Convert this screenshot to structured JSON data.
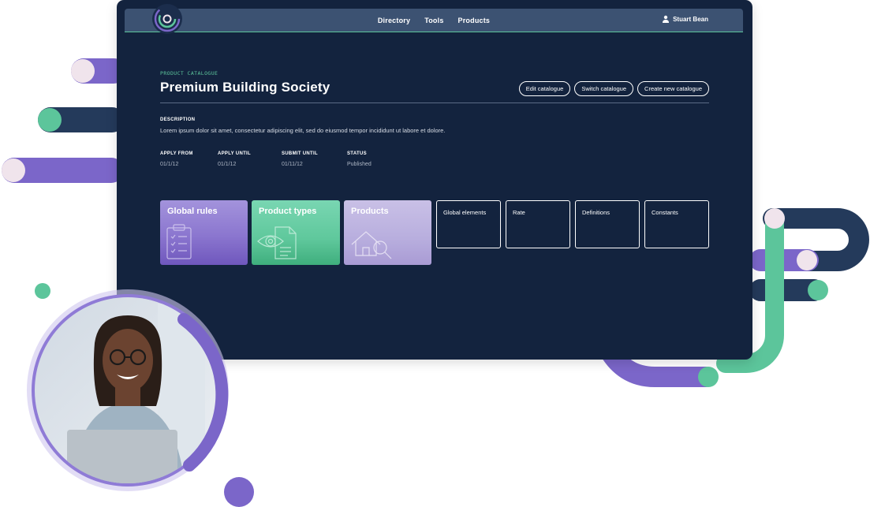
{
  "nav": {
    "items": [
      "Directory",
      "Tools",
      "Products"
    ],
    "user_name": "Stuart Bean"
  },
  "header": {
    "eyebrow": "PRODUCT CATALOGUE",
    "title": "Premium Building Society",
    "actions": [
      "Edit catalogue",
      "Switch catalogue",
      "Create new catalogue"
    ]
  },
  "description": {
    "label": "DESCRIPTION",
    "text": "Lorem ipsum dolor sit amet, consectetur adipiscing elit, sed do eiusmod tempor incididunt ut labore et dolore."
  },
  "meta": [
    {
      "label": "APPLY FROM",
      "value": "01/1/12"
    },
    {
      "label": "APPLY UNTIL",
      "value": "01/1/12"
    },
    {
      "label": "SUBMIT UNTIL",
      "value": "01/11/12"
    },
    {
      "label": "STATUS",
      "value": "Published"
    }
  ],
  "tiles": [
    {
      "label": "Global rules",
      "icon": "clipboard-checklist-icon",
      "color": "#8b76cf"
    },
    {
      "label": "Product types",
      "icon": "eye-document-icon",
      "color": "#5fc89c"
    },
    {
      "label": "Products",
      "icon": "house-search-icon",
      "color": "#b8aede"
    }
  ],
  "outline_tiles": [
    "Global elements",
    "Rate",
    "Definitions",
    "Constants"
  ],
  "colors": {
    "background": "#13233e",
    "topbar": "#3c5272",
    "accent_green": "#5cc59b",
    "accent_purple": "#7b66c9",
    "navy": "#243a5b",
    "blush": "#f0e4ec"
  }
}
